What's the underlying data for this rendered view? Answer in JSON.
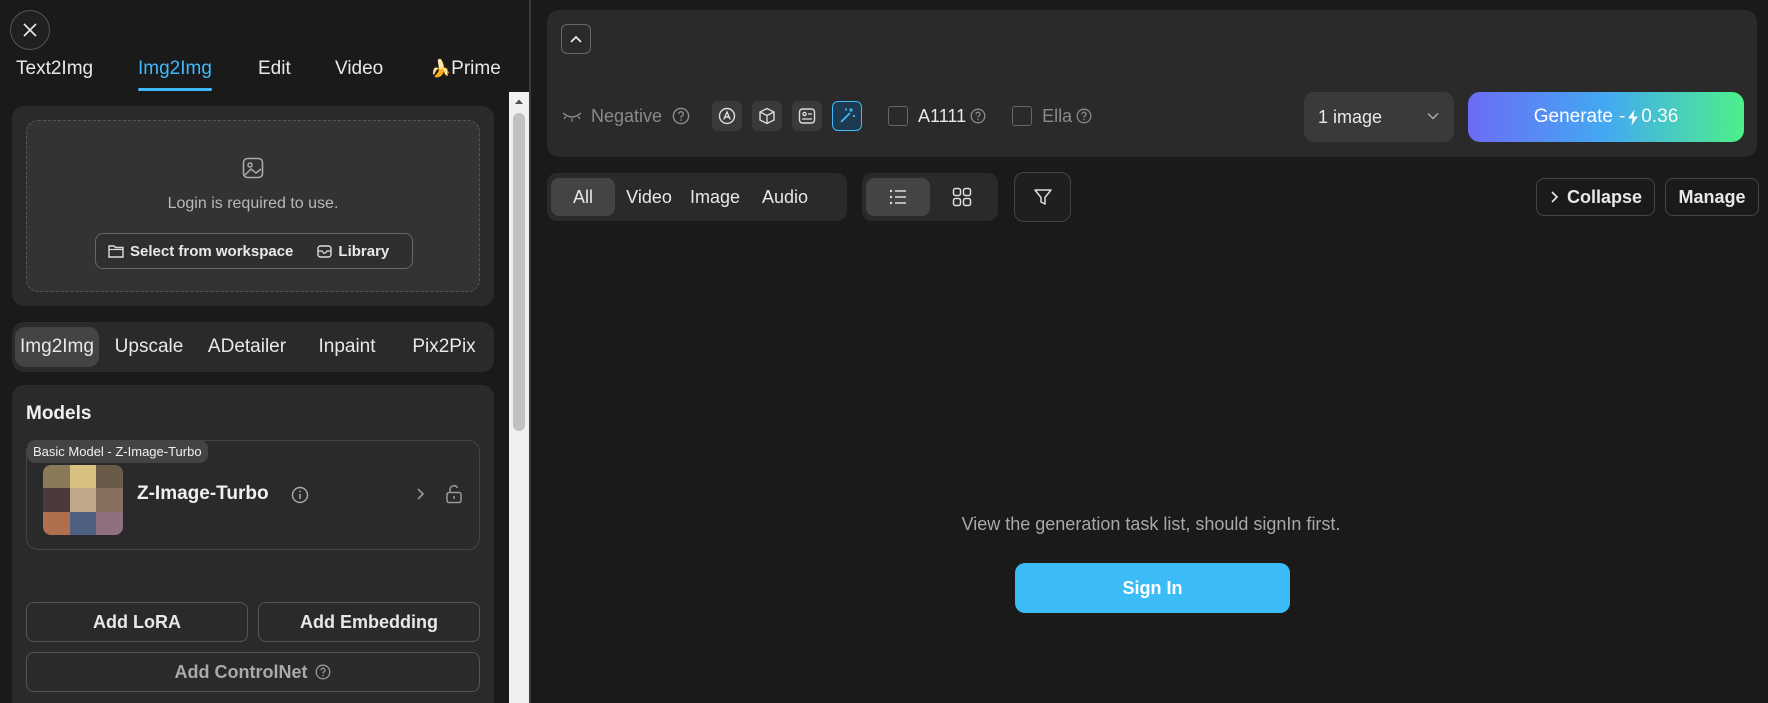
{
  "left_panel": {
    "top_tabs": [
      {
        "label": "Text2Img"
      },
      {
        "label": "Img2Img",
        "active": true
      },
      {
        "label": "Edit"
      },
      {
        "label": "Video"
      },
      {
        "label": "Prime",
        "icon": "banana-icon"
      }
    ],
    "upload": {
      "login_text": "Login is required to use.",
      "select_workspace_label": "Select from workspace",
      "library_label": "Library"
    },
    "mode_tabs": [
      {
        "label": "Img2Img",
        "active": true
      },
      {
        "label": "Upscale"
      },
      {
        "label": "ADetailer"
      },
      {
        "label": "Inpaint"
      },
      {
        "label": "Pix2Pix"
      }
    ],
    "models": {
      "title": "Models",
      "badge": "Basic Model - Z-Image-Turbo",
      "model_name": "Z-Image-Turbo"
    },
    "buttons": {
      "add_lora": "Add LoRA",
      "add_embedding": "Add Embedding",
      "add_controlnet": "Add ControlNet"
    }
  },
  "prompt": {
    "negative_label": "Negative",
    "a1111_label": "A1111",
    "ella_label": "Ella",
    "image_count": "1 image",
    "generate_label": "Generate",
    "generate_cost_prefix": "-",
    "generate_cost": "0.36",
    "accent_gradient": [
      "#6b6cf5",
      "#43a9f2",
      "#4df08a"
    ]
  },
  "tasks": {
    "filters": [
      {
        "label": "All",
        "active": true
      },
      {
        "label": "Video"
      },
      {
        "label": "Image"
      },
      {
        "label": "Audio"
      }
    ],
    "collapse_label": "Collapse",
    "manage_label": "Manage",
    "empty_message": "View the generation task list, should signIn first.",
    "signin_label": "Sign In"
  },
  "colors": {
    "accent": "#3fb8ff",
    "signin": "#3cbcf7",
    "background": "#1a1a1a",
    "card": "#2a2a2a"
  }
}
